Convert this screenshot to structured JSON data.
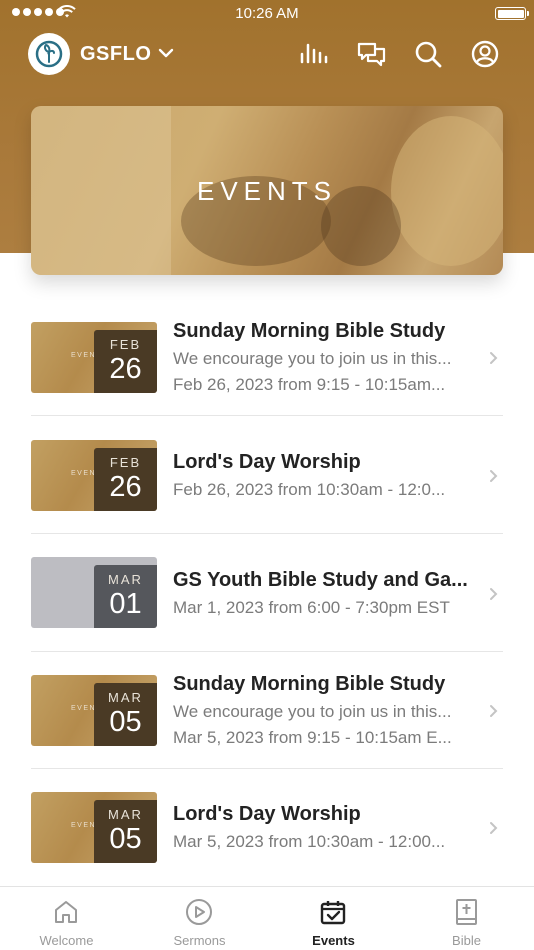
{
  "status_bar": {
    "time": "10:26 AM"
  },
  "header": {
    "org_name": "GSFLO",
    "icons": [
      "logo-icon",
      "chevron-down-icon",
      "stats-icon",
      "chat-icon",
      "search-icon",
      "profile-icon"
    ]
  },
  "hero": {
    "title": "EVENTS"
  },
  "events": [
    {
      "month": "FEB",
      "day": "26",
      "title": "Sunday Morning Bible Study",
      "description": "We encourage you to join us in this...",
      "schedule": "Feb 26, 2023 from 9:15 - 10:15am...",
      "thumb_text": "EVENTS"
    },
    {
      "month": "FEB",
      "day": "26",
      "title": "Lord's Day Worship",
      "description": "",
      "schedule": "Feb 26, 2023 from 10:30am - 12:0...",
      "thumb_text": "EVENTS"
    },
    {
      "month": "MAR",
      "day": "01",
      "title": "GS Youth Bible Study and Ga...",
      "description": "",
      "schedule": "Mar 1, 2023 from 6:00 - 7:30pm EST",
      "thumb_text": ""
    },
    {
      "month": "MAR",
      "day": "05",
      "title": "Sunday Morning Bible Study",
      "description": "We encourage you to join us in this...",
      "schedule": "Mar 5, 2023 from 9:15 - 10:15am E...",
      "thumb_text": "EVENTS"
    },
    {
      "month": "MAR",
      "day": "05",
      "title": "Lord's Day Worship",
      "description": "",
      "schedule": "Mar 5, 2023 from 10:30am - 12:00...",
      "thumb_text": "EVENTS"
    }
  ],
  "tabs": [
    {
      "label": "Welcome",
      "icon": "home-icon",
      "active": false
    },
    {
      "label": "Sermons",
      "icon": "play-icon",
      "active": false
    },
    {
      "label": "Events",
      "icon": "calendar-check-icon",
      "active": true
    },
    {
      "label": "Bible",
      "icon": "bible-icon",
      "active": false
    }
  ],
  "colors": {
    "header": "#a1722d",
    "active_tab": "#222222",
    "inactive_tab": "#9a9a9a"
  }
}
